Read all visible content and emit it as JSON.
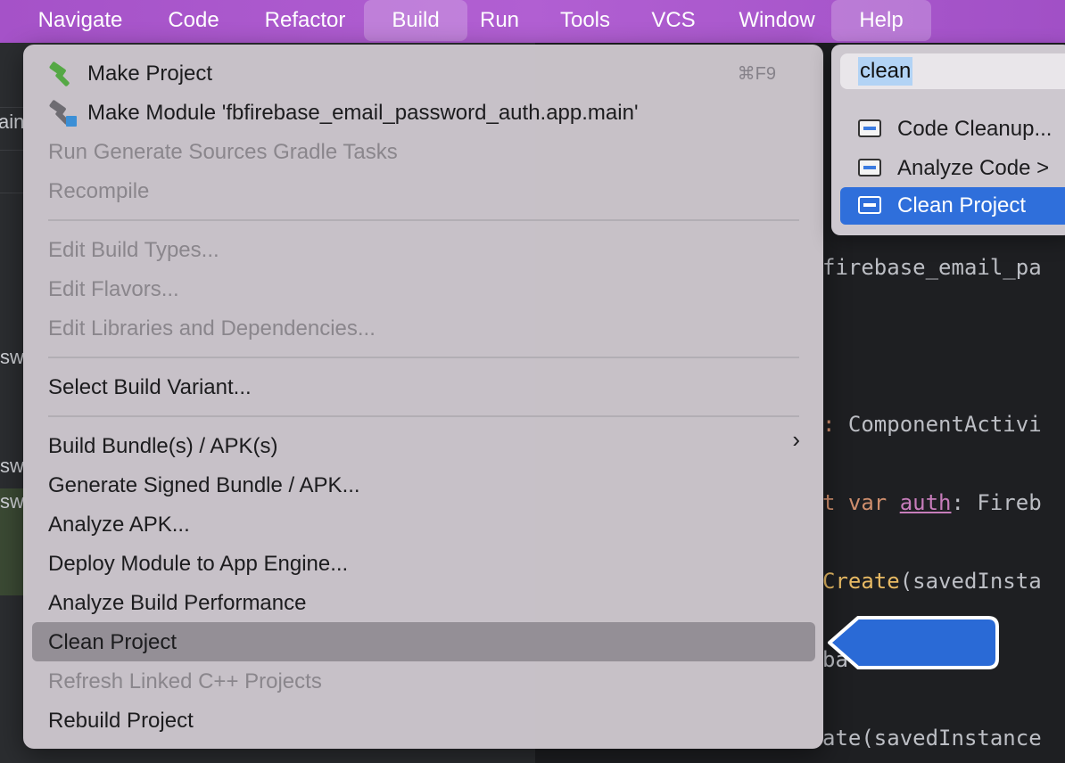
{
  "menubar": {
    "items": [
      {
        "label": "Navigate"
      },
      {
        "label": "Code"
      },
      {
        "label": "Refactor"
      },
      {
        "label": "Build"
      },
      {
        "label": "Run"
      },
      {
        "label": "Tools"
      },
      {
        "label": "VCS"
      },
      {
        "label": "Window"
      },
      {
        "label": "Help"
      }
    ]
  },
  "background": {
    "left_fragments": [
      "ain",
      "sw",
      "sw",
      "sw"
    ],
    "editor": {
      "line1": "firebase_email_pa",
      "line2_prefix": ": ",
      "line2_rest": "ComponentActivi",
      "line3_kw1": "t ",
      "line3_kw2": "var ",
      "line3_prop": "auth",
      "line3_rest": ": Fireb",
      "line4_fn": "Create",
      "line4_rest": "(savedInsta",
      "line5": "ba",
      "line6": "ate(savedInstance"
    }
  },
  "build_menu": {
    "make_project": "Make Project",
    "make_project_shortcut": "⌘F9",
    "make_module": "Make Module 'fbfirebase_email_password_auth.app.main'",
    "run_generate": "Run Generate Sources Gradle Tasks",
    "recompile": "Recompile",
    "edit_build_types": "Edit Build Types...",
    "edit_flavors": "Edit Flavors...",
    "edit_libraries": "Edit Libraries and Dependencies...",
    "select_variant": "Select Build Variant...",
    "build_bundle": "Build Bundle(s) / APK(s)",
    "submenu_chevron": "›",
    "generate_signed": "Generate Signed Bundle / APK...",
    "analyze_apk": "Analyze APK...",
    "deploy_module": "Deploy Module to App Engine...",
    "analyze_build": "Analyze Build Performance",
    "clean_project": "Clean Project",
    "refresh_linked": "Refresh Linked C++ Projects",
    "rebuild_project": "Rebuild Project"
  },
  "search_popup": {
    "query": "clean",
    "results": [
      {
        "label": "Code Cleanup..."
      },
      {
        "label": "Analyze Code >"
      },
      {
        "label": "Clean Project"
      }
    ]
  },
  "colors": {
    "menubar": "#a552c8",
    "highlight": "#948f96",
    "selected_result": "#2f6fdb",
    "pointer_arrow": "#2a6ad6"
  }
}
